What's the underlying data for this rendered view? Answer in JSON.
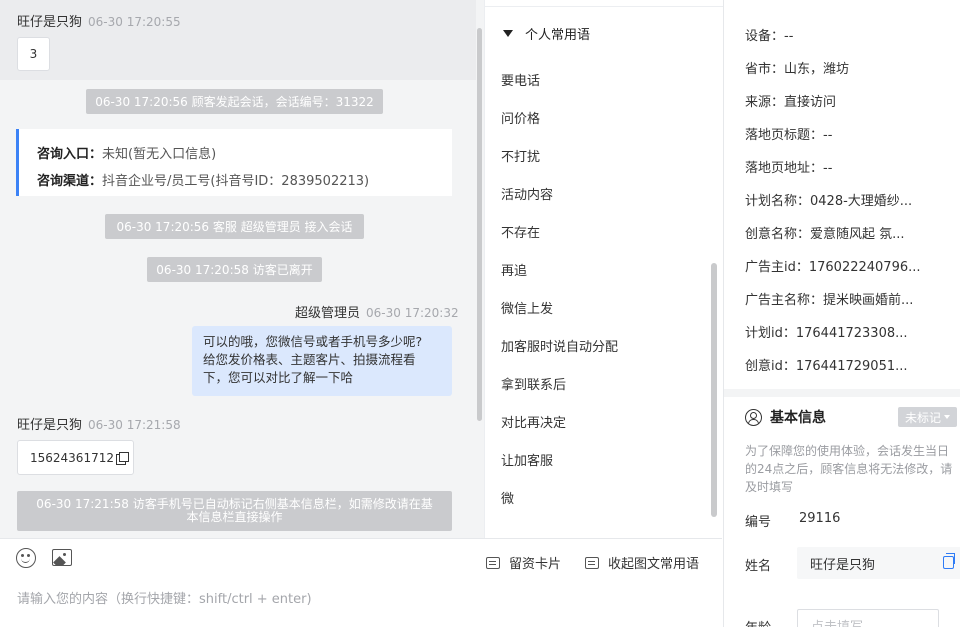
{
  "chat": {
    "msg1": {
      "sender": "旺仔是只狗",
      "time": "06-30 17:20:55",
      "content": "3"
    },
    "sys1": "06-30 17:20:56 顾客发起会话，会话编号：31322",
    "info_card": {
      "entry_label": "咨询入口：",
      "entry_value": "未知(暂无入口信息)",
      "channel_label": "咨询渠道：",
      "channel_value": "抖音企业号/员工号(抖音号ID：2839502213)"
    },
    "sys2": "06-30 17:20:56 客服 超级管理员 接入会话",
    "sys3": "06-30 17:20:58 访客已离开",
    "agent_msg": {
      "sender": "超级管理员",
      "time": "06-30 17:20:32",
      "line1": "可以的哦，您微信号或者手机号多少呢?",
      "line2": "给您发价格表、主题客片、拍摄流程看",
      "line3": "下，您可以对比了解一下哈"
    },
    "msg2": {
      "sender": "旺仔是只狗",
      "time": "06-30 17:21:58",
      "content": "15624361712"
    },
    "sys4_line1": "06-30 17:21:58 访客手机号已自动标记右侧基本信息栏，如需修改请在基",
    "sys4_line2": "本信息栏直接操作"
  },
  "phrases": {
    "header": "个人常用语",
    "items": [
      "要电话",
      "问价格",
      "不打扰",
      "活动内容",
      "不存在",
      "再追",
      "微信上发",
      "加客服时说自动分配",
      "拿到联系后",
      "对比再决定",
      "让加客服",
      "微"
    ]
  },
  "input": {
    "card_btn": "留资卡片",
    "collapse_btn": "收起图文常用语",
    "placeholder": "请输入您的内容（换行快捷键：shift/ctrl + enter)"
  },
  "visit_info": {
    "rows": [
      "设备：--",
      "省市：山东，潍坊",
      "来源：直接访问",
      "落地页标题：--",
      "落地页地址：--",
      "计划名称：0428-大理婚纱...",
      "创意名称：爱意随风起 氛...",
      "广告主id：176022240796...",
      "广告主名称：提米映画婚前...",
      "计划id：176441723308...",
      "创意id：176441729051..."
    ]
  },
  "basic_info": {
    "title": "基本信息",
    "tag": "未标记",
    "notice": "为了保障您的使用体验，会话发生当日的24点之后，顾客信息将无法修改，请及时填写",
    "id_label": "编号",
    "id_value": "29116",
    "name_label": "姓名",
    "name_value": "旺仔是只狗",
    "age_label": "年龄",
    "age_placeholder": "点击填写"
  }
}
